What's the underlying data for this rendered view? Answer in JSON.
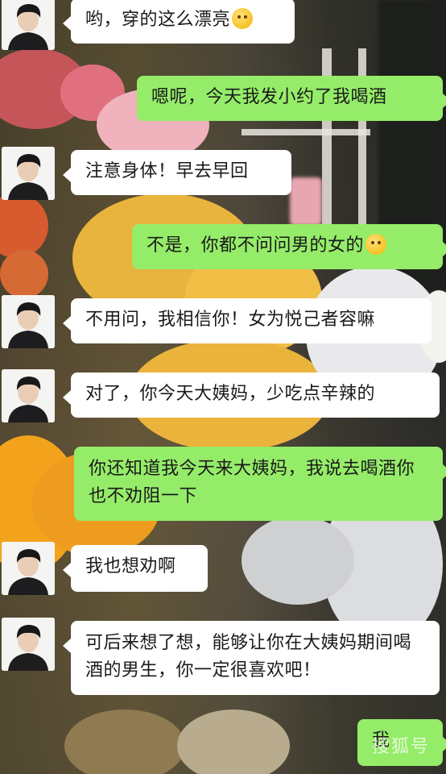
{
  "messages": [
    {
      "side": "left",
      "text": "哟，穿的这么漂亮",
      "emoji": "dizzy-face-emoji"
    },
    {
      "side": "right",
      "text": "嗯呢，今天我发小约了我喝酒"
    },
    {
      "side": "left",
      "text": "注意身体！早去早回"
    },
    {
      "side": "right",
      "text": "不是，你都不问问男的女的",
      "emoji": "pouting-face-emoji"
    },
    {
      "side": "left",
      "text": "不用问，我相信你！女为悦己者容嘛"
    },
    {
      "side": "left",
      "text": "对了，你今天大姨妈，少吃点辛辣的"
    },
    {
      "side": "right",
      "text": "你还知道我今天来大姨妈，我说去喝酒你也不劝阻一下"
    },
    {
      "side": "left",
      "text": "我也想劝啊"
    },
    {
      "side": "left",
      "text": "可后来想了想，能够让你在大姨妈期间喝酒的男生，你一定很喜欢吧！"
    },
    {
      "side": "right",
      "text": "我"
    }
  ],
  "watermark": "搜狐号",
  "colors": {
    "incoming": "#ffffff",
    "outgoing": "#95ec69"
  }
}
